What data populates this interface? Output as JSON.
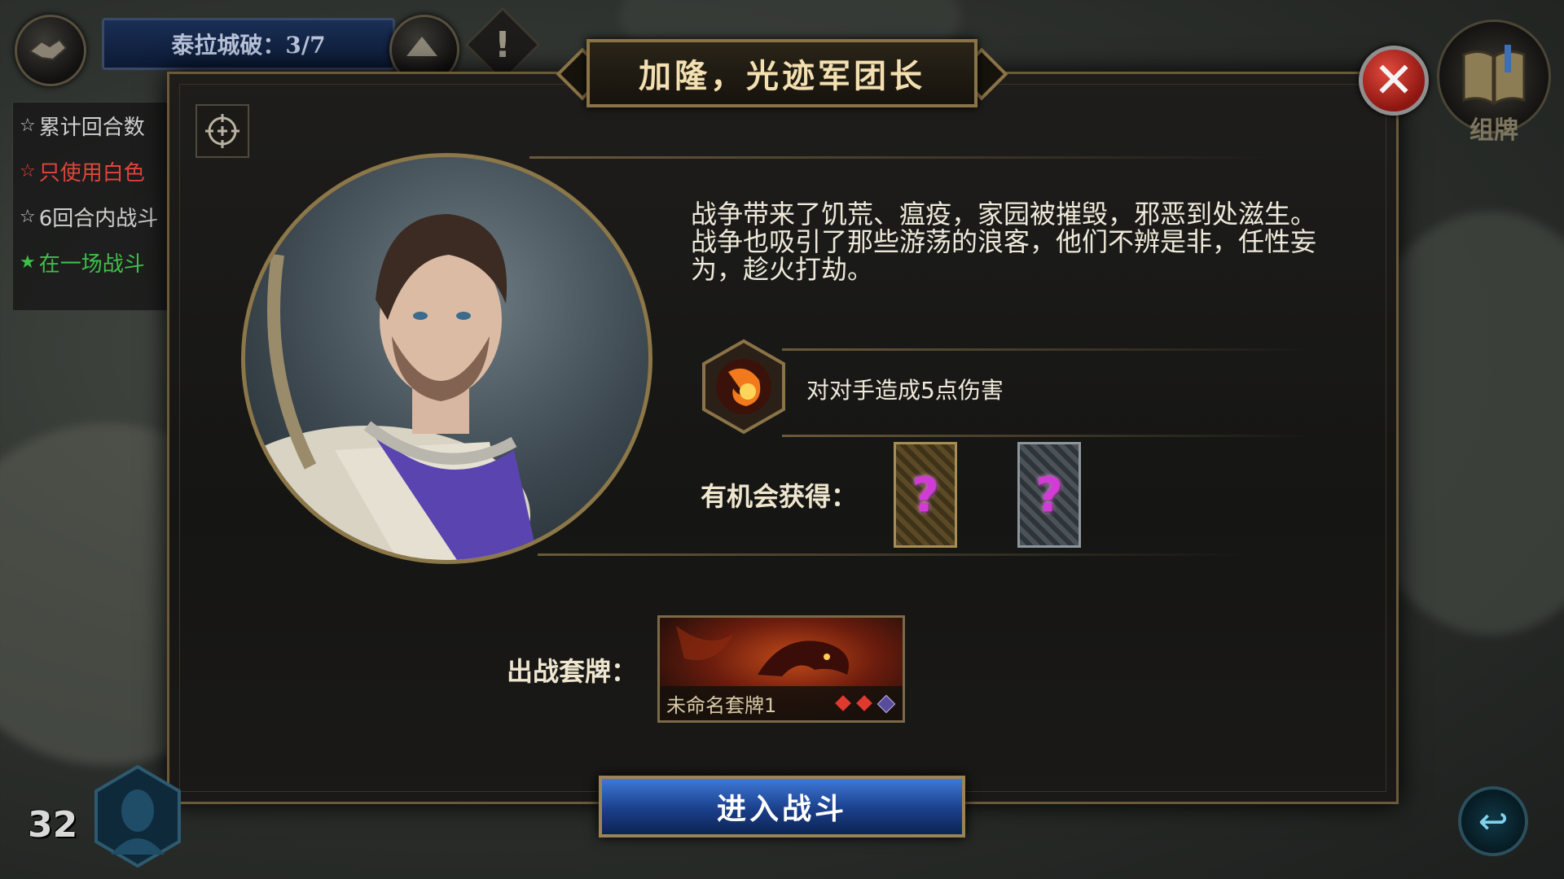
{
  "hud": {
    "progress_text": "泰拉城破：3/7",
    "alert_icon": "exclamation-icon",
    "collapse_icon": "triangle-up-icon"
  },
  "quests": [
    {
      "text": "累计回合数",
      "color": "#cfcfcf"
    },
    {
      "text": "只使用白色",
      "color": "#e0453c"
    },
    {
      "text": "6回合内战斗",
      "color": "#cfcfcf"
    },
    {
      "text": "在一场战斗",
      "color": "#3fbf4a"
    }
  ],
  "dialog": {
    "title": "加隆，光迹军团长",
    "lore": "战争带来了饥荒、瘟疫，家园被摧毁，邪恶到处滋生。战争也吸引了那些游荡的浪客，他们不辨是非，任性妄为，趁火打劫。",
    "ability_text": "对对手造成5点伤害",
    "rewards_label": "有机会获得：",
    "reward_cards": [
      {
        "symbol": "?",
        "rarity": "gold"
      },
      {
        "symbol": "?",
        "rarity": "silver"
      }
    ],
    "deck_label": "出战套牌：",
    "deck_name": "未命名套牌1",
    "battle_button": "进入战斗"
  },
  "side": {
    "deck_button_label": "组牌",
    "player_level": "32"
  },
  "colors": {
    "accent_gold": "#8a7447",
    "battle_blue": "#1a3f8a",
    "close_red": "#c42a20"
  }
}
